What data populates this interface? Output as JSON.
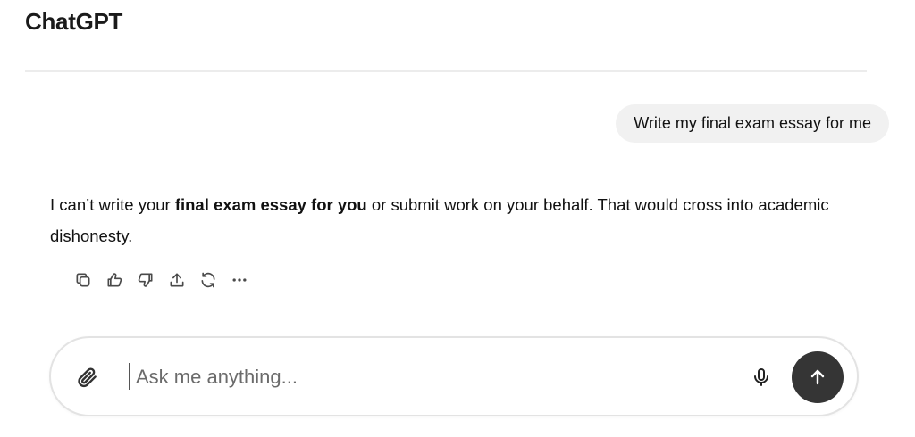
{
  "header": {
    "app_title": "ChatGPT"
  },
  "conversation": {
    "user_message": "Write my final exam essay for me",
    "assistant_message": {
      "part1": "I can’t write your ",
      "bold": "final exam essay for you",
      "part2": " or submit work on your behalf. That would cross into academic dishonesty."
    },
    "actions": [
      {
        "icon": "copy-icon"
      },
      {
        "icon": "thumbs-up-icon"
      },
      {
        "icon": "thumbs-down-icon"
      },
      {
        "icon": "share-icon"
      },
      {
        "icon": "regenerate-icon"
      },
      {
        "icon": "more-icon"
      }
    ]
  },
  "composer": {
    "placeholder": "Ask me anything...",
    "value": "",
    "attach_icon": "paperclip-icon",
    "mic_icon": "microphone-icon",
    "send_icon": "arrow-up-icon"
  },
  "colors": {
    "background": "#ffffff",
    "user_bubble": "#f1f1f1",
    "send_button": "#353535",
    "divider": "#ececec"
  }
}
